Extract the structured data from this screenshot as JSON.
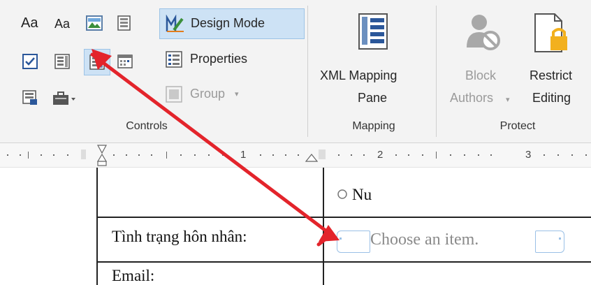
{
  "ribbon": {
    "controls": {
      "aa1": "Aa",
      "aa2": "Aa",
      "design_mode": "Design Mode",
      "properties": "Properties",
      "group": "Group",
      "group_label": "Controls"
    },
    "mapping": {
      "xml_line1": "XML Mapping",
      "xml_line2": "Pane",
      "group_label": "Mapping"
    },
    "protect": {
      "block_line1": "Block",
      "block_line2": "Authors",
      "restrict_line1": "Restrict",
      "restrict_line2": "Editing",
      "group_label": "Protect"
    }
  },
  "ruler": {
    "n1": "1",
    "n2": "2",
    "n3": "3"
  },
  "document": {
    "radio_label": "Nu",
    "marital_label": "Tình trạng hôn nhân:",
    "combo_placeholder": "Choose an item.",
    "email_label": "Email:"
  },
  "colors": {
    "ribbon_bg": "#f3f3f3",
    "design_mode_active": "#cde2f5",
    "annotation_arrow": "#e3242b",
    "content_control_border": "#9ac0e6",
    "gray_text": "#9a9a9a"
  }
}
